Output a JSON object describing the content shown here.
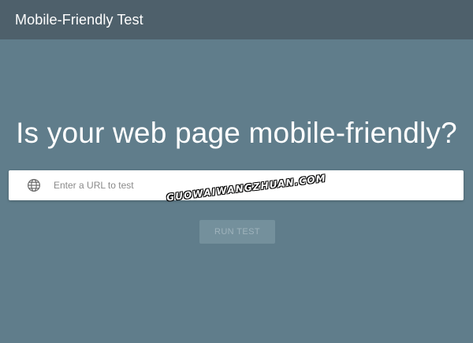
{
  "app_bar": {
    "title": "Mobile-Friendly Test"
  },
  "hero": {
    "heading": "Is your web page mobile-friendly?"
  },
  "url_input": {
    "icon": "globe-icon",
    "placeholder": "Enter a URL to test",
    "value": ""
  },
  "run_test": {
    "label": "RUN TEST",
    "enabled": false
  },
  "watermark": {
    "text": "GUOWAIWANGZHUAN.COM"
  },
  "colors": {
    "background": "#607d8b",
    "app_bar": "#4e606b",
    "button_disabled_bg": "#74909c",
    "button_disabled_text": "#9fb3bc"
  }
}
